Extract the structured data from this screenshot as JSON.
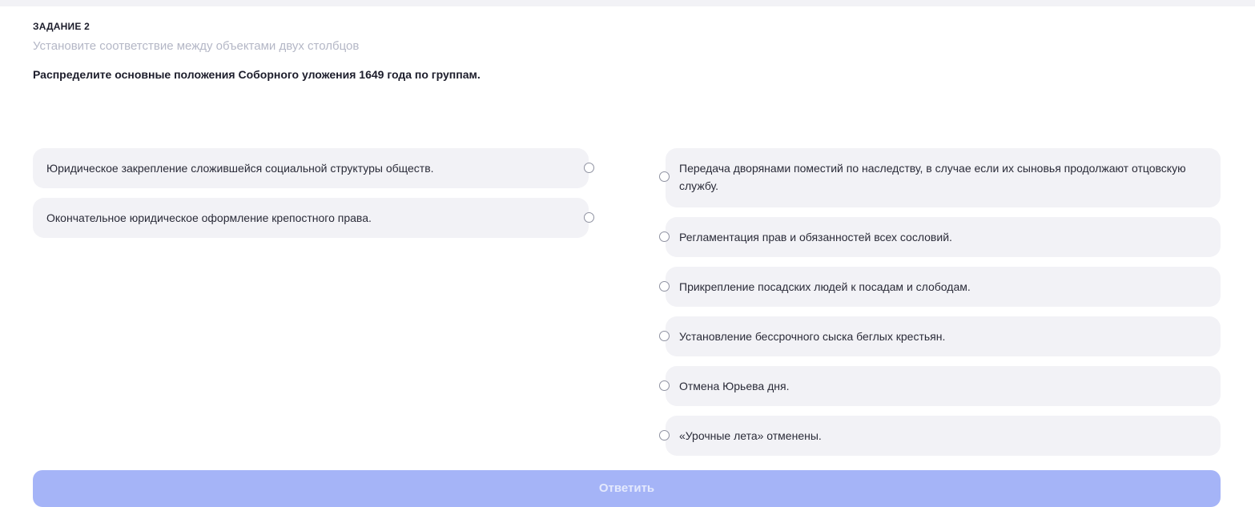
{
  "task": {
    "label": "ЗАДАНИЕ 2",
    "hint": "Установите соответствие между объектами двух столбцов",
    "question": "Распределите основные положения Соборного уложения 1649 года по группам."
  },
  "left_items": [
    {
      "text": "Юридическое закрепление сложившейся социальной   структуры обществ."
    },
    {
      "text": "Окончательное юридическое оформление крепостного права."
    }
  ],
  "right_items": [
    {
      "text": "Передача дворянами поместий по наследству, в случае если их сыновья продолжают отцовскую службу."
    },
    {
      "text": "Регламентация прав и обязанностей всех сословий."
    },
    {
      "text": "Прикрепление посадских людей к посадам и слободам."
    },
    {
      "text": "Установление бессрочного сыска беглых крестьян."
    },
    {
      "text": "Отмена Юрьева дня."
    },
    {
      "text": "«Урочные лета» отменены."
    }
  ],
  "submit": {
    "label": "Ответить"
  },
  "colors": {
    "card_bg": "#f2f2f6",
    "button_bg": "#a5b4f7",
    "hint": "#b4b7c6"
  }
}
